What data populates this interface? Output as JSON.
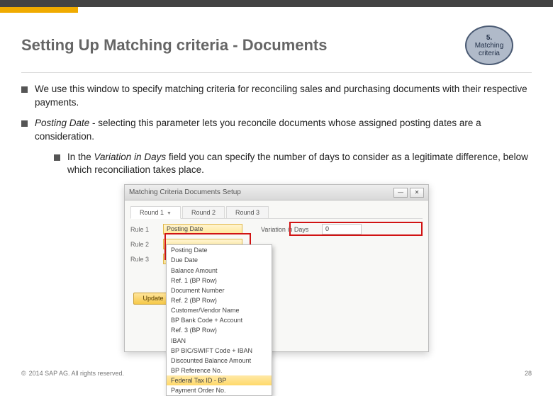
{
  "header": {
    "title": "Setting Up Matching criteria - Documents",
    "badge": {
      "number": "5.",
      "label": "Matching criteria"
    }
  },
  "bullets": {
    "b1": "We use this window to specify matching criteria for reconciling sales and purchasing documents with their respective payments.",
    "b2_em": "Posting Date",
    "b2_rest": " - selecting this parameter lets you reconcile documents whose assigned posting dates are a consideration.",
    "b3_pre": "In the ",
    "b3_em": "Variation in Days",
    "b3_post": " field you can specify the number of days to consider as a legitimate difference, below which reconciliation takes place."
  },
  "dialog": {
    "title": "Matching Criteria  Documents  Setup",
    "tabs": [
      "Round 1",
      "Round 2",
      "Round 3"
    ],
    "rules": {
      "r1": {
        "label": "Rule 1",
        "value": "Posting Date",
        "var_label": "Variation in Days",
        "var_value": "0"
      },
      "r2": {
        "label": "Rule 2"
      },
      "r3": {
        "label": "Rule 3"
      }
    },
    "dropdown": [
      "Posting Date",
      "Due Date",
      "Balance Amount",
      "Ref. 1 (BP Row)",
      "Document Number",
      "Ref. 2 (BP Row)",
      "Customer/Vendor Name",
      "BP Bank Code + Account",
      "Ref. 3 (BP Row)",
      "IBAN",
      "BP BIC/SWIFT Code + IBAN",
      "Discounted Balance Amount",
      "BP Reference No.",
      "Federal Tax ID - BP",
      "Payment Order No."
    ],
    "selected_index": 13,
    "update": "Update"
  },
  "footer": {
    "copyright": "2014 SAP AG. All rights reserved.",
    "page": "28"
  }
}
